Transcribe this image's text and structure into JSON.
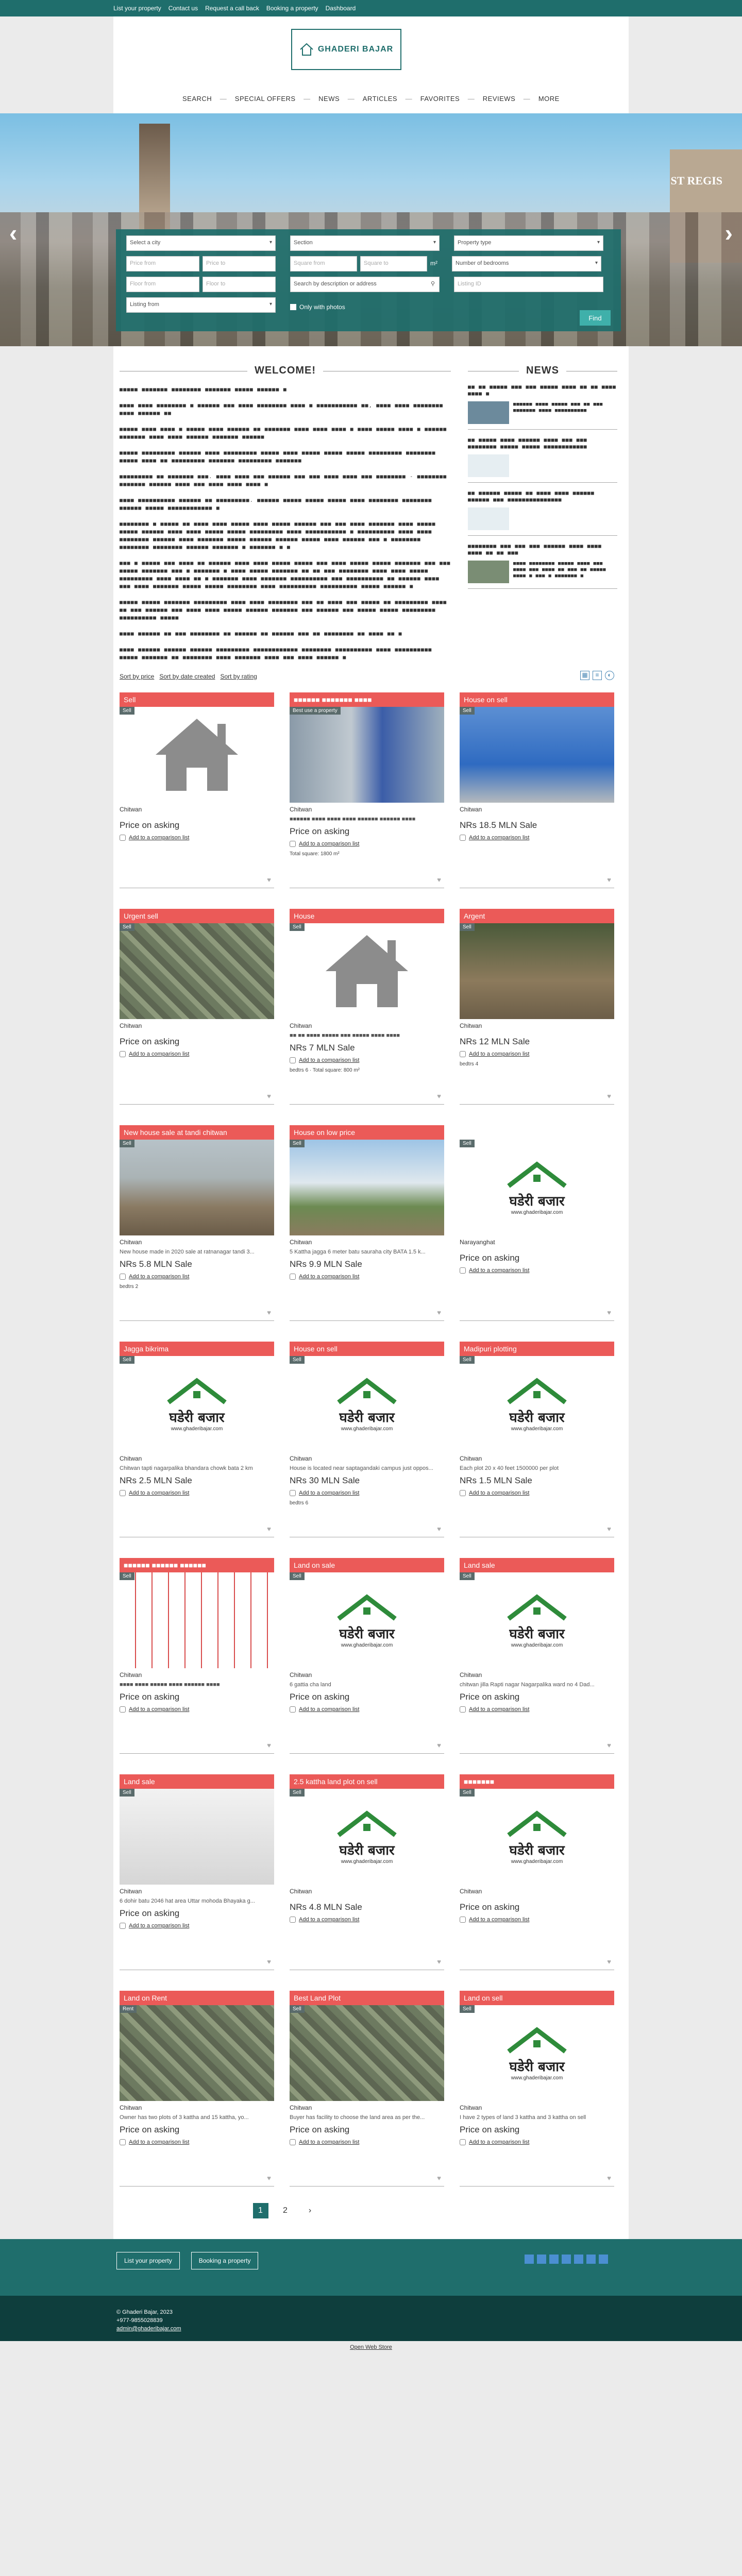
{
  "topbar": {
    "links": [
      "List your property",
      "Contact us",
      "Request a call back",
      "Booking a property",
      "Dashboard"
    ]
  },
  "logo": {
    "text": "GHADERI BAJAR"
  },
  "menu": [
    "SEARCH",
    "SPECIAL OFFERS",
    "NEWS",
    "ARTICLES",
    "FAVORITES",
    "REVIEWS",
    "MORE"
  ],
  "hero": {
    "sign": "ST REGIS"
  },
  "search": {
    "city": "Select a city",
    "section": "Section",
    "property_type": "Property type",
    "price_from": "Price from",
    "price_to": "Price to",
    "sqft_from": "Square from",
    "sqft_to": "Square to",
    "sqft_unit": "m²",
    "bedrooms": "Number of bedrooms",
    "floor_from": "Floor from",
    "floor_to": "Floor to",
    "description": "Search by description or address",
    "listing_id": "Listing ID",
    "listing_from": "Listing from",
    "only_photos": "Only with photos",
    "find": "Find"
  },
  "welcome": {
    "title": "WELCOME!",
    "paragraphs": [
      "■■■■■ ■■■■■■■ ■■■■■■■■ ■■■■■■■ ■■■■■ ■■■■■■ ■",
      "■■■■ ■■■■ ■■■■■■■■ ■ ■■■■■■ ■■■ ■■■■ ■■■■■■■■ ■■■■ ■ ■■■■■■■■■■■ ■■, ■■■■ ■■■■ ■■■■■■■■ ■■■■ ■■■■■■ ■■",
      "■■■■■ ■■■■ ■■■■ ■ ■■■■■ ■■■■ ■■■■■■ ■■ ■■■■■■■ ■■■■ ■■■■ ■■■■ ■ ■■■■ ■■■■■ ■■■■ ■ ■■■■■■ ■■■■■■■ ■■■■ ■■■■ ■■■■■■ ■■■■■■■ ■■■■■■",
      "■■■■■ ■■■■■■■■■ ■■■■■■ ■■■■ ■■■■■■■■■ ■■■■■ ■■■■ ■■■■■ ■■■■■ ■■■■■ ■■■■■■■■■ ■■■■■■■■ ■■■■■ ■■■■ ■■ ■■■■■■■■■ ■■■■■■■ ■■■■■■■■■ ■■■■■■■",
      "■■■■■■■■■ ■■ ■■■■■■■ ■■■. ■■■■ ■■■■ ■■■ ■■■■■■ ■■■ ■■■ ■■■■ ■■■■ ■■■ ■■■■■■■■ - ■■■■■■■■ ■■■■■■■ ■■■■■■ ■■■■ ■■■ ■■■■ ■■■■ ■■■■ ■",
      "■■■■ ■■■■■■■■■■ ■■■■■■ ■■ ■■■■■■■■■. ■■■■■■ ■■■■■ ■■■■■ ■■■■■ ■■■■ ■■■■■■■■ ■■■■■■■■ ■■■■■■ ■■■■■ ■■■■■■■■■■■■ ■",
      "■■■■■■■■ ■ ■■■■■ ■■ ■■■■ ■■■■ ■■■■■ ■■■■ ■■■■■ ■■■■■■ ■■■ ■■■ ■■■■ ■■■■■■■ ■■■■ ■■■■■ ■■■■■ ■■■■■■ ■■■■ ■■■■ ■■■■■ ■■■■■ ■■■■■■■■■ ■■■■ ■■■■■■■■■■■ ■ ■■■■■■■■■■ ■■■■ ■■■■ ■■■■■■■■ ■■■■■■ ■■■■ ■■■■■■■ ■■■■■ ■■■■■■ ■■■■■■ ■■■■■ ■■■■ ■■■■■■ ■■■ ■ ■■■■■■■■ ■■■■■■■■ ■■■■■■■■ ■■■■■■ ■■■■■■■ ■ ■■■■■■■ ■ ■",
      "■■■ ■ ■■■■■ ■■■ ■■■■ ■■ ■■■■■■ ■■■■ ■■■■ ■■■■■ ■■■■■ ■■■ ■■■■ ■■■■■ ■■■■■ ■■■■■■■ ■■■ ■■■ ■■■■■ ■■■■■■■ ■■■ ■ ■■■■■■■ ■ ■■■■ ■■■■■ ■■■■■■■ ■■ ■■ ■■■ ■■■■■■■■ ■■■■ ■■■■ ■■■■■ ■■■■■■■■■ ■■■■ ■■■■ ■■ ■ ■■■■■■■ ■■■■ ■■■■■■■ ■■■■■■■■■■ ■■■ ■■■■■■■■■■ ■■ ■■■■■■ ■■■■ ■■■ ■■■■ ■■■■■■■ ■■■■■ ■■■■■ ■■■■■■■■ ■■■■ ■■■■■■■■■■ ■■■■■■■■■■ ■■■■■ ■■■■■■ ■",
      "■■■■■ ■■■■■ ■■■■■■■ ■■■■■■■■■ ■■■■ ■■■■ ■■■■■■■■ ■■■ ■■ ■■■■ ■■■ ■■■■■ ■■ ■■■■■■■■■ ■■■■ ■■ ■■■ ■■■■■■ ■■■ ■■■■ ■■■■ ■■■■■ ■■■■■■ ■■■■■■■ ■■■ ■■■■■■ ■■■ ■■■■■ ■■■■■ ■■■■■■■■■ ■■■■■■■■■■ ■■■■■",
      "■■■■ ■■■■■■ ■■ ■■■ ■■■■■■■■ ■■ ■■■■■■ ■■ ■■■■■■ ■■■ ■■ ■■■■■■■■ ■■ ■■■■ ■■ ■",
      "■■■■ ■■■■■■ ■■■■■■ ■■■■■■ ■■■■■■■■■ ■■■■■■■■■■■■ ■■■■■■■■ ■■■■■■■■■■ ■■■■ ■■■■■■■■■■ ■■■■■ ■■■■■■■ ■■ ■■■■■■■■ ■■■■ ■■■■■■■ ■■■■ ■■■ ■■■■ ■■■■■■ ■"
    ]
  },
  "news": {
    "title": "NEWS",
    "items": [
      {
        "title": "■■ ■■ ■■■■■ ■■■ ■■■ ■■■■■ ■■■■ ■■ ■■ ■■■■ ■■■■ ■",
        "desc": "■■■■■■ ■■■■ ■■■■■ ■■■ ■■ ■■■ ■■■■■■■ ■■■■ ■■■■■■■■■■"
      },
      {
        "title": "■■ ■■■■■ ■■■■ ■■■■■■ ■■■■ ■■■ ■■■ ■■■■■■■■ ■■■■■ ■■■■■ ■■■■■■■■■■■■",
        "desc": ""
      },
      {
        "title": "■■ ■■■■■■ ■■■■■ ■■ ■■■■ ■■■■ ■■■■■■ ■■■■■■ ■■■ ■■■■■■■■■■■■■■■",
        "desc": ""
      },
      {
        "title": "■■■■■■■■ ■■■ ■■■ ■■■ ■■■■■■ ■■■■ ■■■■ ■■■■ ■■ ■■ ■■■",
        "desc": "■■■■ ■■■■■■■■ ■■■■■ ■■■■ ■■■ ■■■■ ■■■ ■■■■ ■■ ■■■ ■■ ■■■■■ ■■■■ ■ ■■■ ■ ■■■■■■■ ■"
      }
    ]
  },
  "sort": {
    "by_price": "Sort by price",
    "by_date": "Sort by date created",
    "by_rating": "Sort by rating"
  },
  "listings": [
    {
      "title": "Sell",
      "badge": "Sell",
      "city": "Chitwan",
      "desc": "",
      "price": "Price on asking",
      "meta": "",
      "img": "house"
    },
    {
      "title": "■■■■■■ ■■■■■■■ ■■■■",
      "badge": "Best use a property",
      "city": "Chitwan",
      "desc": "■■■■■■ ■■■■ ■■■■ ■■■■ ■■■■■■ ■■■■■■ ■■■■",
      "price": "Price on asking",
      "meta": "Total square: 1800 m²",
      "img": "building"
    },
    {
      "title": "House on sell",
      "badge": "Sell",
      "city": "Chitwan",
      "desc": "",
      "price": "NRs 18.5 MLN Sale",
      "meta": "",
      "img": "blue"
    },
    {
      "title": "Urgent sell",
      "badge": "Sell",
      "city": "Chitwan",
      "desc": "",
      "price": "Price on asking",
      "meta": "",
      "img": "aerial"
    },
    {
      "title": "House",
      "badge": "Sell",
      "city": "Chitwan",
      "desc": "■■ ■■ ■■■■ ■■■■■ ■■■ ■■■■■ ■■■■ ■■■■",
      "price": "NRs 7 MLN Sale",
      "meta": "bedtrs 6 · Total square: 800 m²",
      "img": "house"
    },
    {
      "title": "Argent",
      "badge": "Sell",
      "city": "Chitwan",
      "desc": "",
      "price": "NRs 12 MLN Sale",
      "meta": "bedtrs 4",
      "img": "street"
    },
    {
      "title": "New house sale at tandi chitwan",
      "badge": "Sell",
      "city": "Chitwan",
      "desc": "New house made in 2020 sale at ratnanagar tandi 3...",
      "price": "NRs 5.8 MLN Sale",
      "meta": "bedtrs 2",
      "img": "site"
    },
    {
      "title": "House on low price",
      "badge": "Sell",
      "city": "Chitwan",
      "desc": "5 Kattha jagga 6 meter batu sauraha city BATA 1.5 k...",
      "price": "NRs 9.9 MLN Sale",
      "meta": "",
      "img": "field"
    },
    {
      "title": "",
      "badge": "Sell",
      "city": "Narayanghat",
      "desc": "",
      "price": "Price on asking",
      "meta": "",
      "img": "logo"
    },
    {
      "title": "Jagga bikrima",
      "badge": "Sell",
      "city": "Chitwan",
      "desc": "Chitwan tapti nagarpalika bhandara chowk bata 2 km",
      "price": "NRs 2.5 MLN Sale",
      "meta": "",
      "img": "logo"
    },
    {
      "title": "House on sell",
      "badge": "Sell",
      "city": "Chitwan",
      "desc": "House is located near saptagandaki campus just oppos...",
      "price": "NRs 30 MLN Sale",
      "meta": "bedtrs 6",
      "img": "logo"
    },
    {
      "title": "Madipuri plotting",
      "badge": "Sell",
      "city": "Chitwan",
      "desc": "Each plot 20 x 40 feet 1500000 per plot",
      "price": "NRs 1.5 MLN Sale",
      "meta": "",
      "img": "logo"
    },
    {
      "title": "■■■■■■ ■■■■■■ ■■■■■■",
      "badge": "Sell",
      "city": "Chitwan",
      "desc": "■■■■ ■■■■ ■■■■■ ■■■■ ■■■■■■ ■■■■",
      "price": "Price on asking",
      "meta": "",
      "img": "map"
    },
    {
      "title": "Land on sale",
      "badge": "Sell",
      "city": "Chitwan",
      "desc": "6 gattia cha land",
      "price": "Price on asking",
      "meta": "",
      "img": "logo"
    },
    {
      "title": "Land sale",
      "badge": "Sell",
      "city": "Chitwan",
      "desc": "chitwan jilla Rapti nagar Nagarpalika ward no 4 Dad...",
      "price": "Price on asking",
      "meta": "",
      "img": "logo"
    },
    {
      "title": "Land sale",
      "badge": "Sell",
      "city": "Chitwan",
      "desc": "6 dohir batu 2046 hat area Uttar mohoda Bhayaka g...",
      "price": "Price on asking",
      "meta": "",
      "img": "plan"
    },
    {
      "title": "2.5 kattha land plot on sell",
      "badge": "Sell",
      "city": "Chitwan",
      "desc": "",
      "price": "NRs 4.8 MLN Sale",
      "meta": "",
      "img": "logo"
    },
    {
      "title": "■■■■■■■",
      "badge": "Sell",
      "city": "Chitwan",
      "desc": "",
      "price": "Price on asking",
      "meta": "",
      "img": "logo"
    },
    {
      "title": "Land on Rent",
      "badge": "Rent",
      "city": "Chitwan",
      "desc": "Owner has two plots of 3 kattha and 15 kattha, yo...",
      "price": "Price on asking",
      "meta": "",
      "img": "aerial"
    },
    {
      "title": "Best Land Plot",
      "badge": "Sell",
      "city": "Chitwan",
      "desc": "Buyer has facility to choose the land area as per the...",
      "price": "Price on asking",
      "meta": "",
      "img": "aerial"
    },
    {
      "title": "Land on sell",
      "badge": "Sell",
      "city": "Chitwan",
      "desc": "I have 2 types of land 3 kattha and 3 kattha on sell",
      "price": "Price on asking",
      "meta": "",
      "img": "logo"
    }
  ],
  "compare_label": "Add to a comparison list",
  "pager": [
    "1",
    "2",
    "›"
  ],
  "footer": {
    "btn1": "List your property",
    "btn2": "Booking a property"
  },
  "bottom": {
    "copyright": "© Ghaderi Bajar, 2023",
    "phone": "+977-9855028839",
    "email": "admin@ghaderibajar.com",
    "desktop": "Open Web Store"
  },
  "logo_text": {
    "dev": "घडेरी बजार",
    "domain": "www.ghaderibajar.com"
  }
}
